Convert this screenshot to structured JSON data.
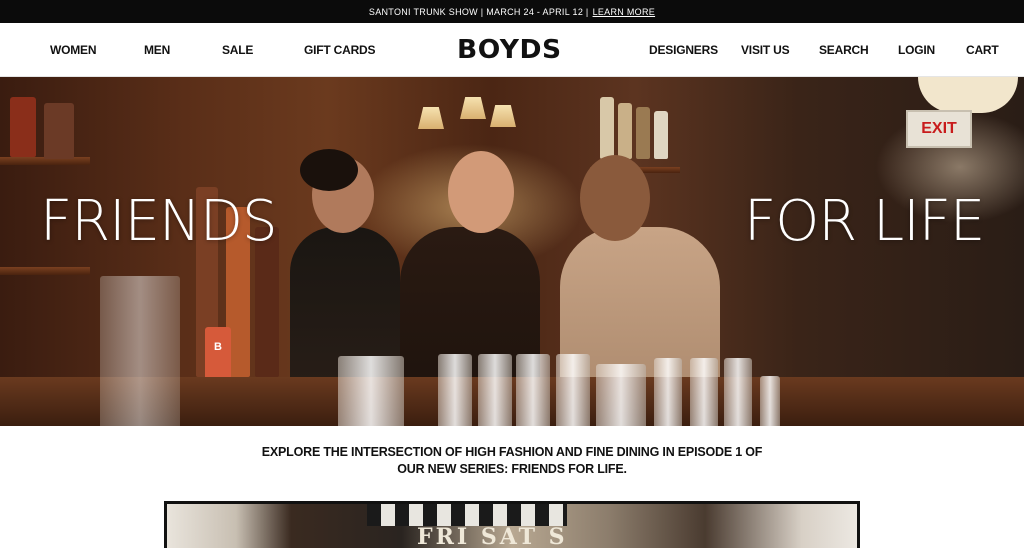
{
  "announcement": {
    "text": "SANTONI TRUNK SHOW | MARCH 24 - APRIL 12 |",
    "link": "LEARN MORE"
  },
  "nav": {
    "left": [
      "WOMEN",
      "MEN",
      "SALE",
      "GIFT CARDS"
    ],
    "logo": "BOYDS",
    "right": [
      "DESIGNERS",
      "VISIT US",
      "SEARCH",
      "LOGIN",
      "CART"
    ]
  },
  "hero": {
    "title_left": "FRIENDS",
    "title_right": "FOR LIFE",
    "exit_sign": "EXIT",
    "bottle_label": "B"
  },
  "intro": {
    "line1": "EXPLORE THE INTERSECTION OF HIGH FASHION AND FINE DINING IN EPISODE 1 OF",
    "line2": "OUR NEW SERIES: FRIENDS FOR LIFE."
  },
  "video": {
    "sign_text": "FRI SAT S"
  },
  "colors": {
    "announcement_bg": "#0b0b0b",
    "text": "#111111",
    "background": "#ffffff"
  }
}
